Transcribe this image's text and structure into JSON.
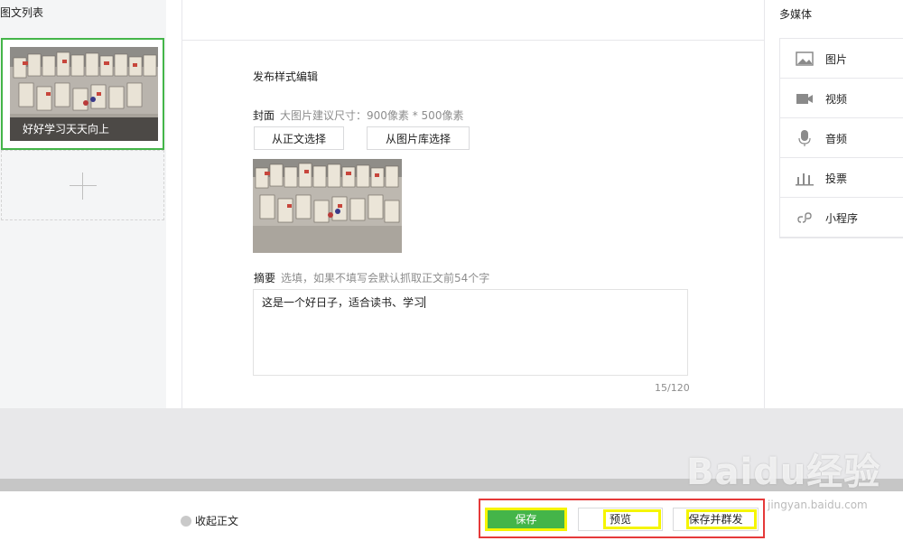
{
  "left_panel": {
    "title": "图文列表",
    "article_card": {
      "caption": "好好学习天天向上"
    }
  },
  "editor": {
    "section_title": "发布样式编辑",
    "cover": {
      "label": "封面",
      "hint": "大图片建议尺寸：900像素 * 500像素",
      "btn_from_body": "从正文选择",
      "btn_from_library": "从图片库选择"
    },
    "digest": {
      "label": "摘要",
      "hint": "选填，如果不填写会默认抓取正文前54个字",
      "value": "这是一个好日子，适合读书、学习",
      "count": "15/120"
    }
  },
  "media_panel": {
    "title": "多媒体",
    "items": [
      {
        "label": "图片",
        "icon": "image-icon"
      },
      {
        "label": "视频",
        "icon": "video-icon"
      },
      {
        "label": "音频",
        "icon": "microphone-icon"
      },
      {
        "label": "投票",
        "icon": "bar-chart-icon"
      },
      {
        "label": "小程序",
        "icon": "link-icon"
      }
    ]
  },
  "footer": {
    "collapse_label": "收起正文",
    "save_label": "保存",
    "preview_label": "预览",
    "save_send_label": "保存并群发"
  },
  "watermark": {
    "text": "Baidu经验",
    "sub": "jingyan.baidu.com"
  },
  "colors": {
    "accent": "#44b549",
    "highlight": "#f5f500",
    "frame": "#e53a3a"
  }
}
